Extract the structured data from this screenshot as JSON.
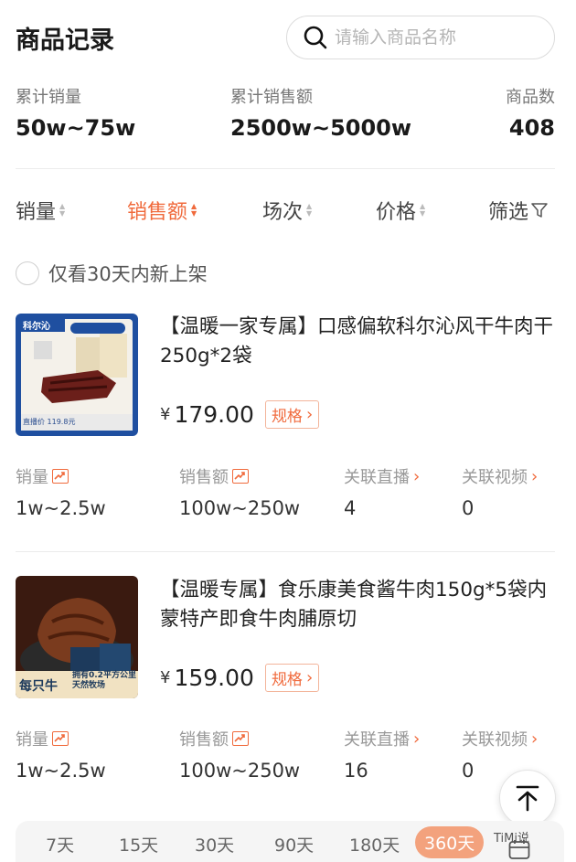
{
  "header": {
    "title": "商品记录",
    "search_placeholder": "请输入商品名称"
  },
  "stats": [
    {
      "label": "累计销量",
      "value": "50w~75w"
    },
    {
      "label": "累计销售额",
      "value": "2500w~5000w"
    },
    {
      "label": "商品数",
      "value": "408"
    }
  ],
  "sort_bar": {
    "items": [
      "销量",
      "销售额",
      "场次",
      "价格",
      "筛选"
    ],
    "active": "销售额"
  },
  "filter": {
    "new_listing_label": "仅看30天内新上架"
  },
  "products": [
    {
      "title": "【温暖一家专属】口感偏软科尔沁风干牛肉干250g*2袋",
      "price_symbol": "¥",
      "price": "179.00",
      "spec_label": "规格",
      "thumb_brand": "科尔沁",
      "thumb_caption": "直播价 119.8元",
      "metrics": {
        "sales_label": "销量",
        "sales": "1w~2.5w",
        "revenue_label": "销售额",
        "revenue": "100w~250w",
        "live_label": "关联直播",
        "live": "4",
        "video_label": "关联视频",
        "video": "0"
      }
    },
    {
      "title": "【温暖专属】食乐康美食酱牛肉150g*5袋内蒙特产即食牛肉脯原切",
      "price_symbol": "¥",
      "price": "159.00",
      "spec_label": "规格",
      "thumb_brand": "每只牛",
      "thumb_caption": "拥有0.2平方公里 天然牧场",
      "metrics": {
        "sales_label": "销量",
        "sales": "1w~2.5w",
        "revenue_label": "销售额",
        "revenue": "100w~250w",
        "live_label": "关联直播",
        "live": "16",
        "video_label": "关联视频",
        "video": "0"
      }
    }
  ],
  "time_bar": {
    "items": [
      "7天",
      "15天",
      "30天",
      "90天",
      "180天",
      "360天"
    ],
    "active": "360天"
  },
  "watermark": "TiMi说",
  "colors": {
    "accent": "#f06a3c",
    "accent_light": "#f3a27d",
    "text_primary": "#222222",
    "text_secondary": "#999999"
  }
}
